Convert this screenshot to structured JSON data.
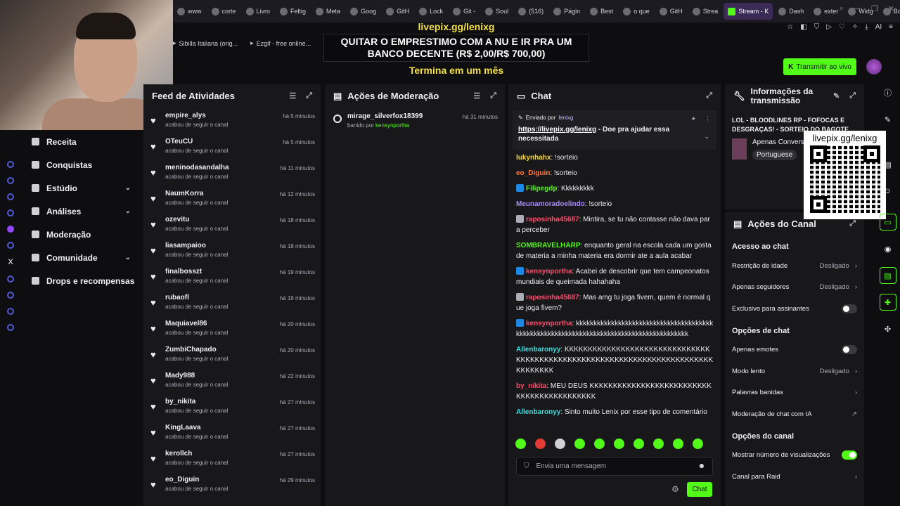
{
  "browser": {
    "tabs": [
      {
        "label": "www",
        "active": false
      },
      {
        "label": "corte",
        "active": false
      },
      {
        "label": "Livro",
        "active": false
      },
      {
        "label": "Feltig",
        "active": false
      },
      {
        "label": "Meta",
        "active": false
      },
      {
        "label": "Goog",
        "active": false
      },
      {
        "label": "GitH",
        "active": false
      },
      {
        "label": "Lock",
        "active": false
      },
      {
        "label": "Git -",
        "active": false
      },
      {
        "label": "Soul",
        "active": false
      },
      {
        "label": "(516)",
        "active": false
      },
      {
        "label": "Págin",
        "active": false
      },
      {
        "label": "Best",
        "active": false
      },
      {
        "label": "o que",
        "active": false
      },
      {
        "label": "GitH",
        "active": false
      },
      {
        "label": "Strea",
        "active": false
      },
      {
        "label": "Stream - K",
        "active": true
      },
      {
        "label": "Dash",
        "active": false
      },
      {
        "label": "exter",
        "active": false
      },
      {
        "label": "Widg",
        "active": false
      },
      {
        "label": "BotR",
        "active": false
      }
    ],
    "bookmarks": [
      "Sibilla Italiana (orig...",
      "Ezgif - free online..."
    ],
    "ai_label": "AI"
  },
  "overlay": {
    "url": "livepix.gg/lenixg",
    "goal_title": "QUITAR O EMPRESTIMO COM A NU E IR PRA UM BANCO DECENTE (R$ 2,00/R$ 700,00)",
    "ends": "Termina em um mês"
  },
  "header": {
    "go_live": "Transmitir ao vivo"
  },
  "nav": {
    "items": [
      {
        "label": "Receita",
        "icon": "receipt-icon",
        "chevron": false
      },
      {
        "label": "Conquistas",
        "icon": "trophy-icon",
        "chevron": false
      },
      {
        "label": "Estúdio",
        "icon": "studio-icon",
        "chevron": true
      },
      {
        "label": "Análises",
        "icon": "analytics-icon",
        "chevron": true
      },
      {
        "label": "Moderação",
        "icon": "wrench-icon",
        "chevron": false
      },
      {
        "label": "Comunidade",
        "icon": "community-icon",
        "chevron": true
      },
      {
        "label": "Drops e recompensas",
        "icon": "gift-icon",
        "chevron": false
      }
    ],
    "rail_label": "X"
  },
  "feed": {
    "title": "Feed de Atividades",
    "items": [
      {
        "name": "empire_alys",
        "sub": "acabou de seguir o canal",
        "time": "há 5 minutos"
      },
      {
        "name": "OTeuCU",
        "sub": "acabou de seguir o canal",
        "time": "há 5 minutos"
      },
      {
        "name": "meninodasandalha",
        "sub": "acabou de seguir o canal",
        "time": "há 11 minutos"
      },
      {
        "name": "NaumKorra",
        "sub": "acabou de seguir o canal",
        "time": "há 12 minutos"
      },
      {
        "name": "ozevitu",
        "sub": "acabou de seguir o canal",
        "time": "há 18 minutos"
      },
      {
        "name": "liasampaioo",
        "sub": "acabou de seguir o canal",
        "time": "há 18 minutos"
      },
      {
        "name": "finalbosszt",
        "sub": "acabou de seguir o canal",
        "time": "há 19 minutos"
      },
      {
        "name": "rubaofl",
        "sub": "acabou de seguir o canal",
        "time": "há 19 minutos"
      },
      {
        "name": "Maquiavel86",
        "sub": "acabou de seguir o canal",
        "time": "há 20 minutos"
      },
      {
        "name": "ZumbiChapado",
        "sub": "acabou de seguir o canal",
        "time": "há 20 minutos"
      },
      {
        "name": "Mady988",
        "sub": "acabou de seguir o canal",
        "time": "há 22 minutos"
      },
      {
        "name": "by_nikita",
        "sub": "acabou de seguir o canal",
        "time": "há 27 minutos"
      },
      {
        "name": "KingLaava",
        "sub": "acabou de seguir o canal",
        "time": "há 27 minutos"
      },
      {
        "name": "kerollch",
        "sub": "acabou de seguir o canal",
        "time": "há 27 minutos"
      },
      {
        "name": "eo_Diguin",
        "sub": "acabou de seguir o canal",
        "time": "há 29 minutos"
      }
    ]
  },
  "moderation": {
    "title": "Ações de Moderação",
    "items": [
      {
        "user": "mirage_silverfox18399",
        "action": "banido por",
        "by": "kensynportha",
        "time": "há 31 minutos"
      }
    ]
  },
  "chat": {
    "title": "Chat",
    "pinned": {
      "sent_by": "Enviado por",
      "user": "lenixg",
      "link": "https://livepix.gg/lenixg",
      "text": " - Doe pra ajudar essa necessitada"
    },
    "messages": [
      {
        "user": "lukynhahx",
        "color": "#fdd835",
        "text": ": !sorteio",
        "badge": ""
      },
      {
        "user": "eo_Diguin",
        "color": "#ff7a3d",
        "text": ": !sorteio",
        "badge": ""
      },
      {
        "user": "Filipegdp",
        "color": "#53fc18",
        "text": ": Kkkkkkkkk",
        "badge": "#1e88e5"
      },
      {
        "user": "Meunamoradoelindo",
        "color": "#a78bfa",
        "text": ": !sorteio",
        "badge": ""
      },
      {
        "user": "raposinha45687",
        "color": "#ff4d6d",
        "text": ": Mintira, se tu não contasse não dava para perceber",
        "badge": "#adadb8"
      },
      {
        "user": "SOMBRAVELHARP",
        "color": "#53fc18",
        "text": ": enquanto geral na escola cada um gosta de materia a minha materia era dormir ate a aula acabar",
        "badge": ""
      },
      {
        "user": "kensynportha",
        "color": "#ff4d6d",
        "text": ": Acabei de descobrir que tem campeonatos mundiais de queimada hahahaha",
        "badge": "#1e88e5"
      },
      {
        "user": "raposinha45687",
        "color": "#ff4d6d",
        "text": ": Mas amg tu joga fivem, quem é normal que joga fivem?",
        "badge": "#adadb8"
      },
      {
        "user": "kensynportha",
        "color": "#ff4d6d",
        "text": ": kkkkkkkkkkkkkkkkkkkkkkkkkkkkkkkkkkkkkkkkkkkkkkkkkkkkkkkkkkkkkkkkkkkkkkkkkkkkkkkkkkkkkkkk",
        "badge": "#1e88e5"
      },
      {
        "user": "Allenbaronyy",
        "color": "#38e0e0",
        "text": ": KKKKKKKKKKKKKKKKKKKKKKKKKKKKKKKKKKKKKKKKKKKKKKKKKKKKKKKKKKKKKKKKKKKKKKKKKKKKKKKKK",
        "badge": ""
      },
      {
        "user": "by_nikita",
        "color": "#ff4d6d",
        "text": ": MEU DEUS KKKKKKKKKKKKKKKKKKKKKKKKKKKKKKKKKKKKKKKKKKK",
        "badge": ""
      },
      {
        "user": "Allenbaronyy",
        "color": "#38e0e0",
        "text": ": Sinto muito Lenix por esse tipo de comentário",
        "badge": ""
      }
    ],
    "placeholder": "Envia uma mensagem",
    "send": "Chat"
  },
  "info": {
    "title": "Informações da transmissão",
    "stream_title": "LOL - BLOODLINES RP - FOFOCAS E DESGRAÇAS! - SORTEIO DO BAGOTE",
    "category": "Apenas Convers",
    "language": "Portuguese"
  },
  "qr": {
    "label": "livepix.gg/lenixg"
  },
  "actions": {
    "title": "Ações do Canal",
    "sections": [
      {
        "title": "Acesso ao chat",
        "rows": [
          {
            "label": "Restrição de idade",
            "value": "Desligado",
            "type": "select"
          },
          {
            "label": "Apenas seguidores",
            "value": "Desligado",
            "type": "select"
          },
          {
            "label": "Exclusivo para assinantes",
            "value": "off",
            "type": "toggle"
          }
        ]
      },
      {
        "title": "Opções de chat",
        "rows": [
          {
            "label": "Apenas emotes",
            "value": "off",
            "type": "toggle"
          },
          {
            "label": "Modo lento",
            "value": "Desligado",
            "type": "select"
          },
          {
            "label": "Palavras banidas",
            "value": "",
            "type": "link"
          },
          {
            "label": "Moderação de chat com IA",
            "value": "",
            "type": "external"
          }
        ]
      },
      {
        "title": "Opções do canal",
        "rows": [
          {
            "label": "Mostrar número de visualizações",
            "value": "on",
            "type": "toggle"
          },
          {
            "label": "Canal para Raid",
            "value": "",
            "type": "link"
          }
        ]
      }
    ]
  },
  "colors": {
    "accent": "#53fc18",
    "panel": "#18181b",
    "background": "#0e0e10"
  }
}
